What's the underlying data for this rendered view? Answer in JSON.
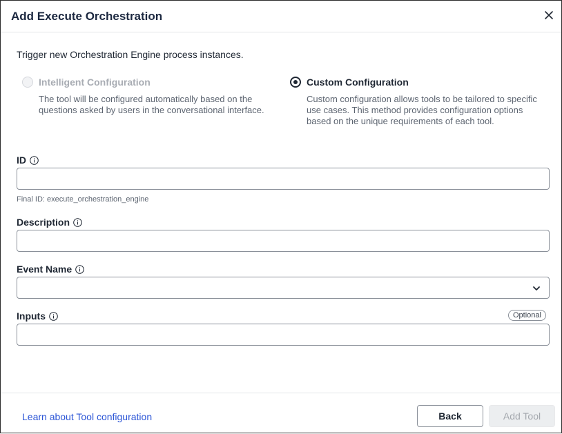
{
  "dialog": {
    "title": "Add Execute Orchestration",
    "subtitle": "Trigger new Orchestration Engine process instances."
  },
  "config_options": [
    {
      "label": "Intelligent Configuration",
      "description": "The tool will be configured automatically based on the questions asked by users in the conversational interface.",
      "state": "disabled"
    },
    {
      "label": "Custom Configuration",
      "description": "Custom configuration allows tools to be tailored to specific use cases. This method provides configuration options based on the unique requirements of each tool.",
      "state": "selected"
    }
  ],
  "fields": {
    "id": {
      "label": "ID",
      "value": "",
      "helper": "Final ID: execute_orchestration_engine"
    },
    "description": {
      "label": "Description",
      "value": ""
    },
    "event_name": {
      "label": "Event Name",
      "value": ""
    },
    "inputs": {
      "label": "Inputs",
      "value": "",
      "badge": "Optional"
    }
  },
  "footer": {
    "learn_link": "Learn about Tool configuration",
    "back_label": "Back",
    "add_label": "Add Tool"
  },
  "icons": {
    "close": "close-icon",
    "info": "info-icon",
    "chevron": "chevron-down-icon"
  },
  "colors": {
    "title": "#1c2840",
    "link": "#2b55d6",
    "disabled_text": "#a8acb3"
  }
}
